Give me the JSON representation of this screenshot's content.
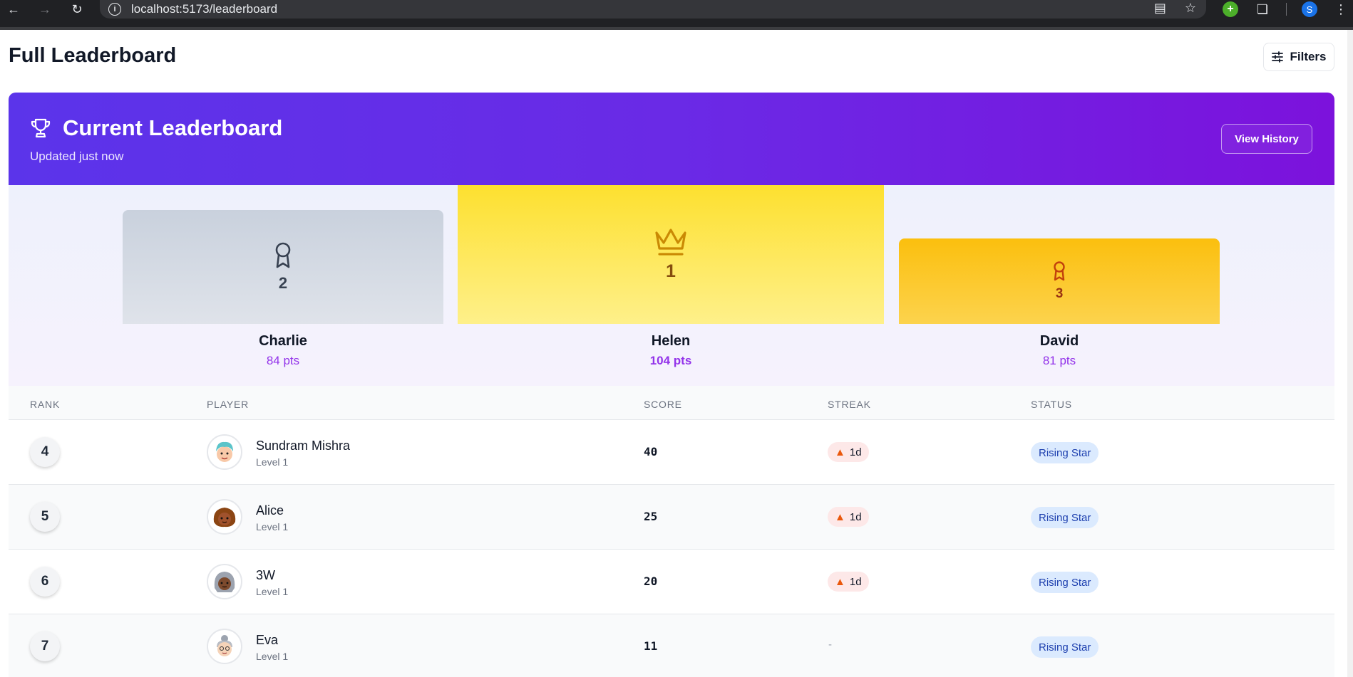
{
  "browser": {
    "url": "localhost:5173/leaderboard",
    "profile_initial": "S"
  },
  "page": {
    "title": "Full Leaderboard",
    "filters_label": "Filters"
  },
  "header": {
    "title": "Current Leaderboard",
    "subtitle": "Updated just now",
    "history_label": "View History",
    "gradient_start": "#5b34ea",
    "gradient_end": "#7c12dc"
  },
  "podium": {
    "first": {
      "rank": "1",
      "name": "Helen",
      "points": "104 pts",
      "icon": "crown-icon",
      "color": "#fde02f"
    },
    "second": {
      "rank": "2",
      "name": "Charlie",
      "points": "84 pts",
      "icon": "award-icon",
      "color": "#c9d1dd"
    },
    "third": {
      "rank": "3",
      "name": "David",
      "points": "81 pts",
      "icon": "award-icon",
      "color": "#fbbf0e"
    }
  },
  "table": {
    "columns": [
      "RANK",
      "PLAYER",
      "SCORE",
      "STREAK",
      "STATUS"
    ],
    "rows": [
      {
        "rank": "4",
        "name": "Sundram Mishra",
        "level": "Level 1",
        "score": "40",
        "streak": "1d",
        "status": "Rising Star"
      },
      {
        "rank": "5",
        "name": "Alice",
        "level": "Level 1",
        "score": "25",
        "streak": "1d",
        "status": "Rising Star"
      },
      {
        "rank": "6",
        "name": "3W",
        "level": "Level 1",
        "score": "20",
        "streak": "1d",
        "status": "Rising Star"
      },
      {
        "rank": "7",
        "name": "Eva",
        "level": "Level 1",
        "score": "11",
        "streak": "-",
        "status": "Rising Star"
      }
    ]
  },
  "colors": {
    "accent_purple": "#9333ea",
    "status_badge_bg": "#dbeafe",
    "status_badge_text": "#1e40af",
    "streak_bg": "#fde8e8"
  }
}
